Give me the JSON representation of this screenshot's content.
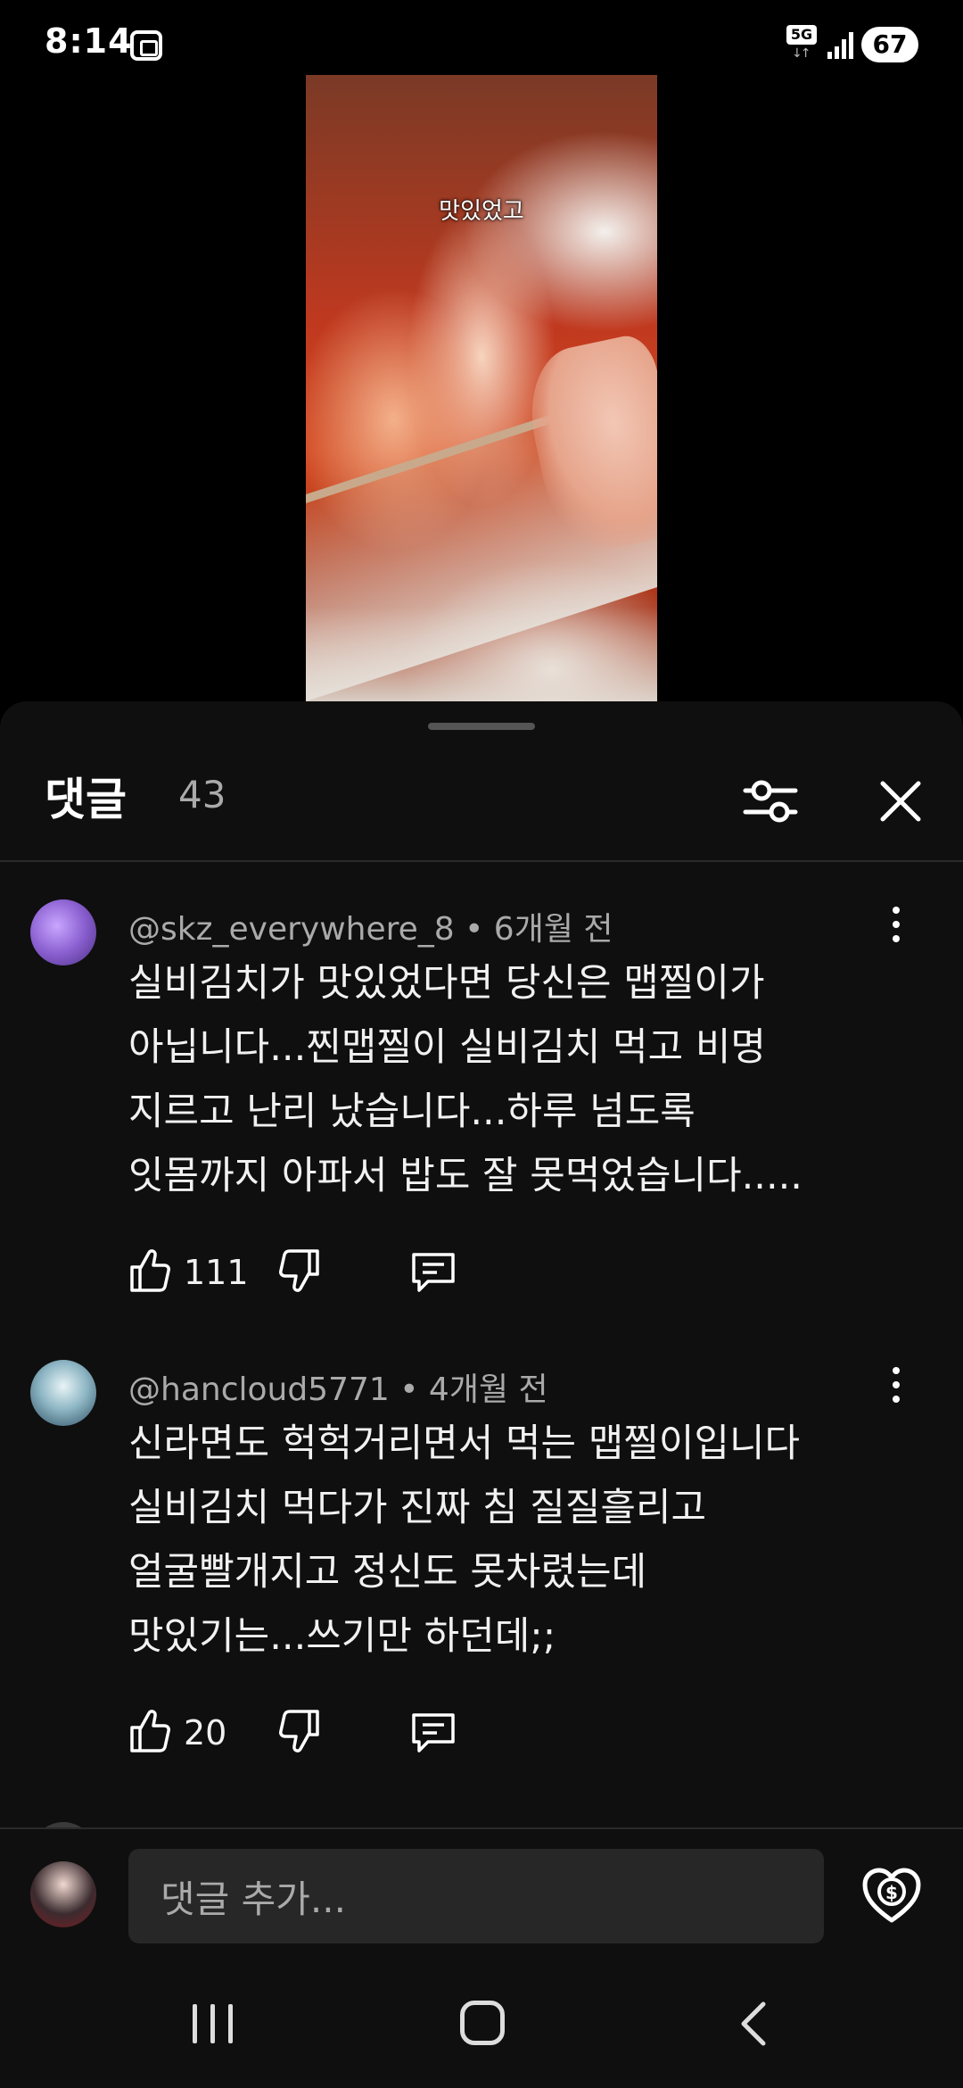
{
  "status_bar": {
    "time": "8:14",
    "network": "5G",
    "battery": "67"
  },
  "video": {
    "caption": "맛있었고"
  },
  "comments_panel": {
    "title": "댓글",
    "count": "43",
    "icons": {
      "filter": "sliders-icon",
      "close": "close-icon"
    }
  },
  "comments": [
    {
      "meta": "@skz_everywhere_8 • 6개월 전",
      "lines": [
        "실비김치가 맛있었다면 당신은 맵찔이가",
        "아닙니다...찐맵찔이 실비김치 먹고 비명",
        "지르고 난리 났습니다...하루 넘도록",
        "잇몸까지 아파서 밥도 잘 못먹었습니다....."
      ],
      "likes": "111"
    },
    {
      "meta": "@hancloud5771 • 4개월 전",
      "lines": [
        "신라면도 헉헉거리면서 먹는 맵찔이입니다",
        "실비김치 먹다가 진짜 침 질질흘리고",
        "얼굴빨개지고 정신도 못차렸는데",
        "맛있기는...쓰기만 하던데;;"
      ],
      "likes": "20"
    }
  ],
  "composer": {
    "placeholder": "댓글 추가..."
  },
  "colors": {
    "sheet_bg": "#0f0f0f",
    "input_bg": "#272727",
    "secondary_text": "#aaaaaa"
  }
}
